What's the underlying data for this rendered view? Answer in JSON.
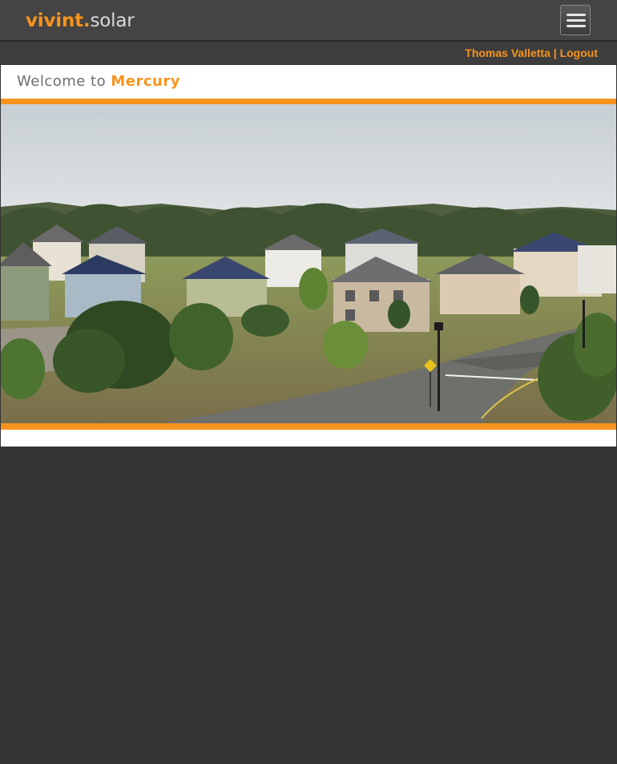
{
  "header": {
    "logo_brand": "vivint",
    "logo_dot": ".",
    "logo_product": "solar",
    "menu_icon": "hamburger-menu-icon"
  },
  "userbar": {
    "user_name": "Thomas Valletta",
    "separator": "|",
    "logout_label": "Logout"
  },
  "welcome": {
    "prefix": "Welcome to",
    "app_name": "Mercury"
  },
  "colors": {
    "accent": "#f7941d",
    "header_bg": "#444444",
    "page_bg": "#333333"
  }
}
